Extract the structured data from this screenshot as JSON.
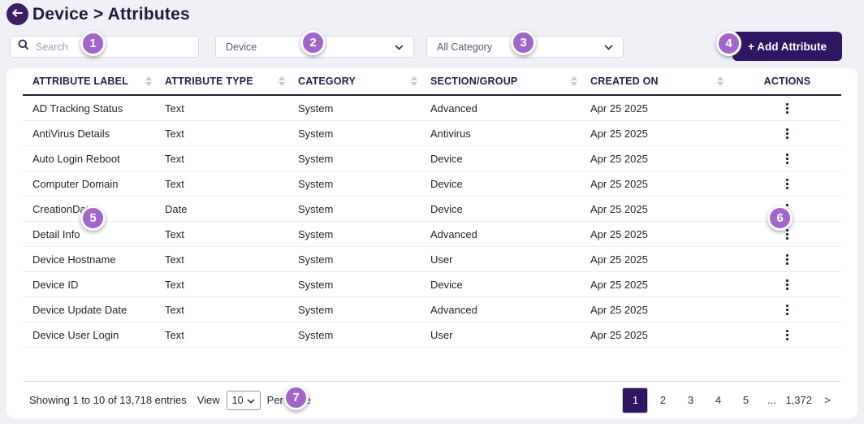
{
  "header": {
    "title": "Device > Attributes"
  },
  "filters": {
    "search": {
      "placeholder": "Search"
    },
    "module_select": {
      "value": "Device"
    },
    "category_select": {
      "value": "All Category"
    },
    "add_attribute": {
      "label": "+ Add Attribute"
    }
  },
  "table": {
    "columns": [
      {
        "label": "ATTRIBUTE LABEL",
        "sortable": true
      },
      {
        "label": "ATTRIBUTE TYPE",
        "sortable": true
      },
      {
        "label": "CATEGORY",
        "sortable": true
      },
      {
        "label": "SECTION/GROUP",
        "sortable": true
      },
      {
        "label": "CREATED ON",
        "sortable": true
      },
      {
        "label": "ACTIONS",
        "sortable": false
      }
    ],
    "rows": [
      {
        "label": "AD Tracking Status",
        "type": "Text",
        "category": "System",
        "section": "Advanced",
        "created_on": "Apr 25 2025"
      },
      {
        "label": "AntiVirus Details",
        "type": "Text",
        "category": "System",
        "section": "Antivirus",
        "created_on": "Apr 25 2025"
      },
      {
        "label": "Auto Login Reboot",
        "type": "Text",
        "category": "System",
        "section": "Device",
        "created_on": "Apr 25 2025"
      },
      {
        "label": "Computer Domain",
        "type": "Text",
        "category": "System",
        "section": "Device",
        "created_on": "Apr 25 2025"
      },
      {
        "label": "CreationDate",
        "type": "Date",
        "category": "System",
        "section": "Device",
        "created_on": "Apr 25 2025"
      },
      {
        "label": "Detail Info",
        "type": "Text",
        "category": "System",
        "section": "Advanced",
        "created_on": "Apr 25 2025"
      },
      {
        "label": "Device Hostname",
        "type": "Text",
        "category": "System",
        "section": "User",
        "created_on": "Apr 25 2025"
      },
      {
        "label": "Device ID",
        "type": "Text",
        "category": "System",
        "section": "Device",
        "created_on": "Apr 25 2025"
      },
      {
        "label": "Device Update Date",
        "type": "Text",
        "category": "System",
        "section": "Advanced",
        "created_on": "Apr 25 2025"
      },
      {
        "label": "Device User Login",
        "type": "Text",
        "category": "System",
        "section": "User",
        "created_on": "Apr 25 2025"
      }
    ]
  },
  "footer": {
    "showing_text": "Showing 1 to 10 of 13,718 entries",
    "view_label": "View",
    "per_page": {
      "value": "10"
    },
    "per_page_label": "Per Page",
    "pagination": {
      "pages": [
        "1",
        "2",
        "3",
        "4",
        "5",
        "...",
        "1,372"
      ],
      "next": ">",
      "active": "1"
    }
  },
  "annotations": {
    "badges": [
      "1",
      "2",
      "3",
      "4",
      "5",
      "6",
      "7"
    ]
  },
  "colors": {
    "page_bg": "#eff1f7",
    "brand_purple": "#3b1f66",
    "button_purple": "#2f1663",
    "badge_purple": "#a266cb",
    "header_text": "#1b2150",
    "active_page_bg": "#2f1663"
  }
}
